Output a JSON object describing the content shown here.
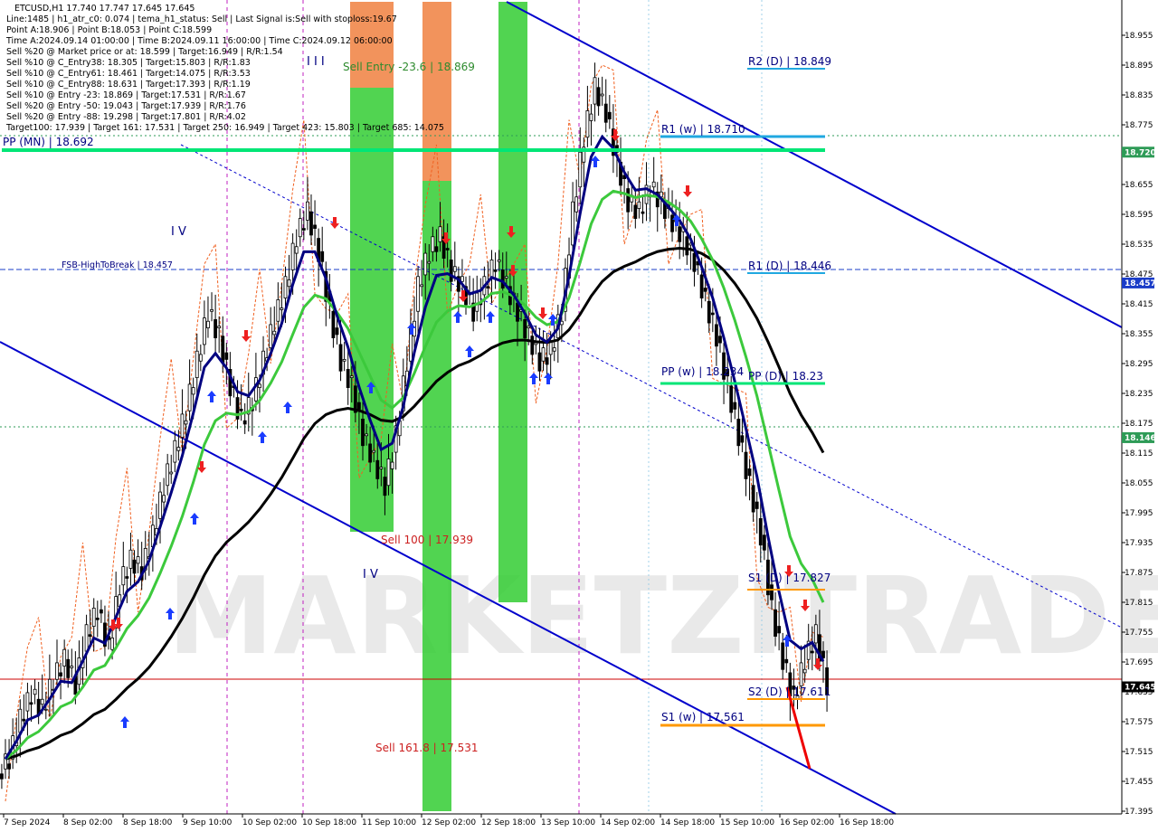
{
  "info": {
    "lines": [
      "ETCUSD,H1  17.740 17.747 17.645 17.645",
      "Line:1485 | h1_atr_c0: 0.074 | tema_h1_status: Sell | Last Signal is:Sell with stoploss:19.67",
      "Point A:18.906 | Point B:18.053 | Point C:18.599",
      "Time A:2024.09.14 01:00:00 | Time B:2024.09.11 16:00:00 | Time C:2024.09.12 06:00:00",
      "Sell %20 @ Market price or at: 18.599 | Target:16.949 | R/R:1.54",
      "Sell %10 @ C_Entry38: 18.305 | Target:15.803 | R/R:1.83",
      "Sell %10 @ C_Entry61: 18.461 | Target:14.075 | R/R:3.53",
      "Sell %10 @ C_Entry88: 18.631 | Target:17.393 | R/R:1.19",
      "Sell %10 @ Entry -23: 18.869 | Target:17.531 | R/R:1.67",
      "Sell %20 @ Entry -50: 19.043 | Target:17.939 | R/R:1.76",
      "Sell %20 @ Entry -88: 19.298 | Target:17.801 | R/R:4.02",
      "Target100: 17.939 | Target 161: 17.531 | Target 250: 16.949 | Target 423: 15.803 | Target 685: 14.075"
    ]
  },
  "chart_data": {
    "type": "candlestick",
    "symbol": "ETCUSD",
    "timeframe": "H1",
    "ylim": [
      17.395,
      18.995
    ],
    "y_ticks": [
      "18.955",
      "18.895",
      "18.835",
      "18.775",
      "18.715",
      "18.655",
      "18.595",
      "18.535",
      "18.475",
      "18.415",
      "18.355",
      "18.295",
      "18.235",
      "18.175",
      "18.115",
      "18.055",
      "17.995",
      "17.935",
      "17.875",
      "17.815",
      "17.755",
      "17.695",
      "17.635",
      "17.575",
      "17.515",
      "17.455",
      "17.395"
    ],
    "x_ticks": [
      "7 Sep 2024",
      "8 Sep 02:00",
      "8 Sep 18:00",
      "9 Sep 10:00",
      "10 Sep 02:00",
      "10 Sep 18:00",
      "11 Sep 10:00",
      "12 Sep 02:00",
      "12 Sep 18:00",
      "13 Sep 10:00",
      "14 Sep 02:00",
      "14 Sep 18:00",
      "15 Sep 10:00",
      "16 Sep 02:00",
      "16 Sep 18:00"
    ],
    "current_price": "17.645",
    "price_tags": [
      {
        "value": 18.72,
        "text": "18.720",
        "color": "#2e9b57"
      },
      {
        "value": 18.457,
        "text": "18.457",
        "color": "#1a3cc8"
      },
      {
        "value": 18.146,
        "text": "18.146",
        "color": "#2e9b57"
      },
      {
        "value": 17.645,
        "text": "17.645",
        "color": "#000000"
      }
    ],
    "levels": [
      {
        "label": "R2 (D) | 18.849",
        "value": 18.849,
        "color": "#20a8e0",
        "y_offset": 0
      },
      {
        "label": "R1 (w) | 18.710",
        "value": 18.72,
        "color": "#20a8e0",
        "y_offset": 0
      },
      {
        "label": "PP (MN) | 18.692",
        "value": 18.692,
        "color": "#00e676",
        "y_offset": 0
      },
      {
        "label": "R1 (D) | 18.446",
        "value": 18.446,
        "color": "#20a8e0",
        "y_offset": 0
      },
      {
        "label": "PP (w) | 18.234",
        "value": 18.234,
        "color": "#00e676",
        "y_offset": 0
      },
      {
        "label": "PP (D) | 18.23",
        "value": 18.234,
        "color": "#00e676",
        "y_offset": 0
      },
      {
        "label": "S1 (D) | 17.827",
        "value": 17.827,
        "color": "#ff9800",
        "y_offset": 0
      },
      {
        "label": "S2 (D) | 17.611",
        "value": 17.611,
        "color": "#ff9800",
        "y_offset": 0
      },
      {
        "label": "S1 (w) | 17.561",
        "value": 17.561,
        "color": "#ff9800",
        "y_offset": 0
      }
    ],
    "labels": {
      "sell_entry": "Sell Entry -23.6 | 18.869",
      "sell_100": "Sell 100 | 17.939",
      "sell_161": "Sell 161.8 | 17.531",
      "fsb": "FSB-HighToBreak | 18.457",
      "wave_iii": "I I I",
      "wave_iv_upper": "I V",
      "wave_iv_lower": "I V"
    },
    "series": [
      {
        "name": "EMA fast",
        "color": "#000080"
      },
      {
        "name": "EMA mid",
        "color": "#3cc93c"
      },
      {
        "name": "EMA slow",
        "color": "#000000"
      }
    ],
    "candles_sampled": [
      17.5,
      17.58,
      17.63,
      17.6,
      17.66,
      17.7,
      17.65,
      17.75,
      17.8,
      17.72,
      17.85,
      17.9,
      17.88,
      17.95,
      18.05,
      18.12,
      18.2,
      18.3,
      18.4,
      18.35,
      18.25,
      18.18,
      18.22,
      18.3,
      18.38,
      18.45,
      18.55,
      18.6,
      18.52,
      18.4,
      18.3,
      18.25,
      18.15,
      18.1,
      18.05,
      18.15,
      18.3,
      18.45,
      18.52,
      18.55,
      18.48,
      18.45,
      18.4,
      18.45,
      18.5,
      18.45,
      18.4,
      18.35,
      18.3,
      18.32,
      18.4,
      18.6,
      18.75,
      18.85,
      18.8,
      18.7,
      18.62,
      18.6,
      18.65,
      18.62,
      18.58,
      18.55,
      18.5,
      18.42,
      18.35,
      18.25,
      18.15,
      18.05,
      17.95,
      17.8,
      17.7,
      17.62,
      17.7,
      17.75,
      17.65
    ]
  },
  "watermark": "MARKETZITRADE",
  "colors": {
    "green_zone": "#33cc33",
    "orange_zone": "#f08040",
    "channel": "#0000cc",
    "resistance": "#20a8e0",
    "support": "#ff9800",
    "pivot": "#00e676",
    "bear_candle": "#000000",
    "bull_candle": "#ffffff"
  }
}
